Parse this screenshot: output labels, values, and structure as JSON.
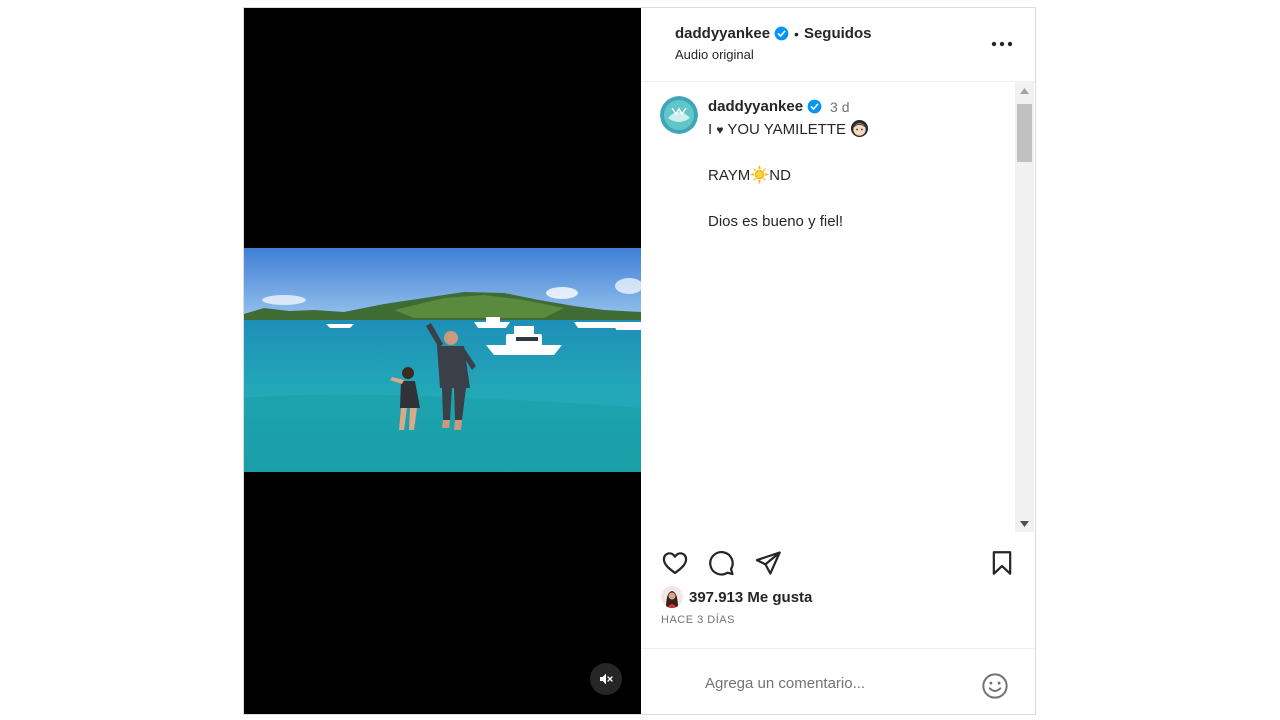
{
  "post": {
    "author": "daddyyankee",
    "separator": "•",
    "follow_status": "Seguidos",
    "audio": "Audio original",
    "caption": {
      "author": "daddyyankee",
      "time": "3 d",
      "line1_prefix": "I ",
      "line1_heart": "♥",
      "line1_suffix": " YOU YAMILETTE",
      "line2_prefix": "RAYM",
      "line2_suffix": "ND",
      "line3": "Dios es bueno y fiel!"
    },
    "likes": "397.913 Me gusta",
    "date": "HACE 3 DÍAS",
    "comment_placeholder": "Agrega un comentario..."
  },
  "icons": {
    "verified": "verified-badge-icon",
    "more": "more-options-icon",
    "like": "heart-icon",
    "comment": "comment-icon",
    "share": "send-icon",
    "save": "bookmark-icon",
    "emoji": "emoji-icon",
    "mute": "muted-speaker-icon"
  },
  "colors": {
    "verified": "#0095f6",
    "text": "#262626",
    "secondary": "#737373"
  }
}
